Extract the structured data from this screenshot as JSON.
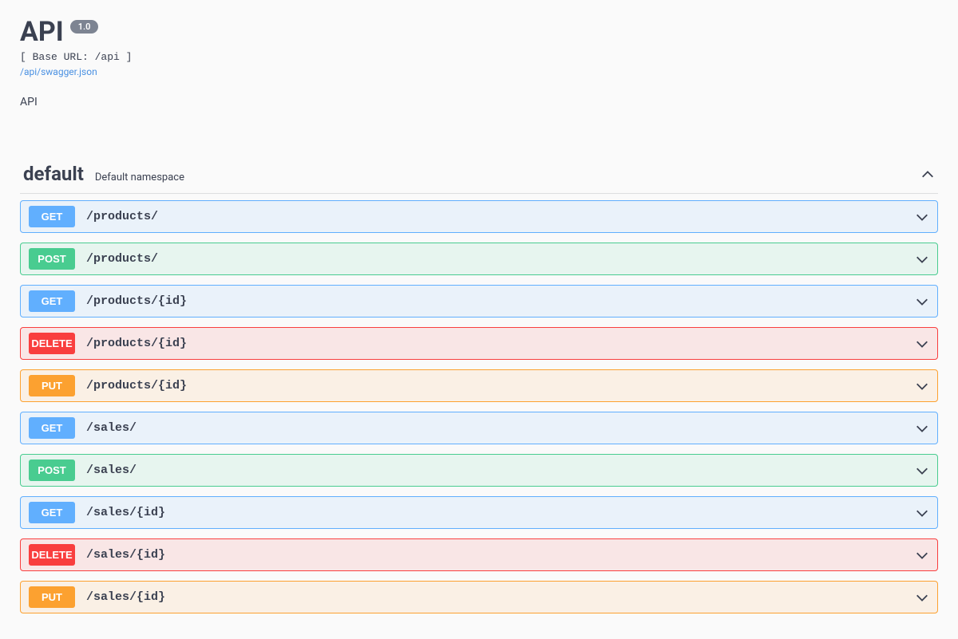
{
  "header": {
    "title": "API",
    "version": "1.0",
    "base_url_label": "[ Base URL: /api ]",
    "spec_link": "/api/swagger.json",
    "short_desc": "API"
  },
  "tag": {
    "name": "default",
    "description": "Default namespace"
  },
  "methods": {
    "get": "GET",
    "post": "POST",
    "delete": "DELETE",
    "put": "PUT"
  },
  "operations": [
    {
      "method": "get",
      "path": "/products/"
    },
    {
      "method": "post",
      "path": "/products/"
    },
    {
      "method": "get",
      "path": "/products/{id}"
    },
    {
      "method": "delete",
      "path": "/products/{id}"
    },
    {
      "method": "put",
      "path": "/products/{id}"
    },
    {
      "method": "get",
      "path": "/sales/"
    },
    {
      "method": "post",
      "path": "/sales/"
    },
    {
      "method": "get",
      "path": "/sales/{id}"
    },
    {
      "method": "delete",
      "path": "/sales/{id}"
    },
    {
      "method": "put",
      "path": "/sales/{id}"
    }
  ],
  "colors": {
    "get": "#61affe",
    "post": "#49cc90",
    "delete": "#f93e3e",
    "put": "#fca130"
  }
}
